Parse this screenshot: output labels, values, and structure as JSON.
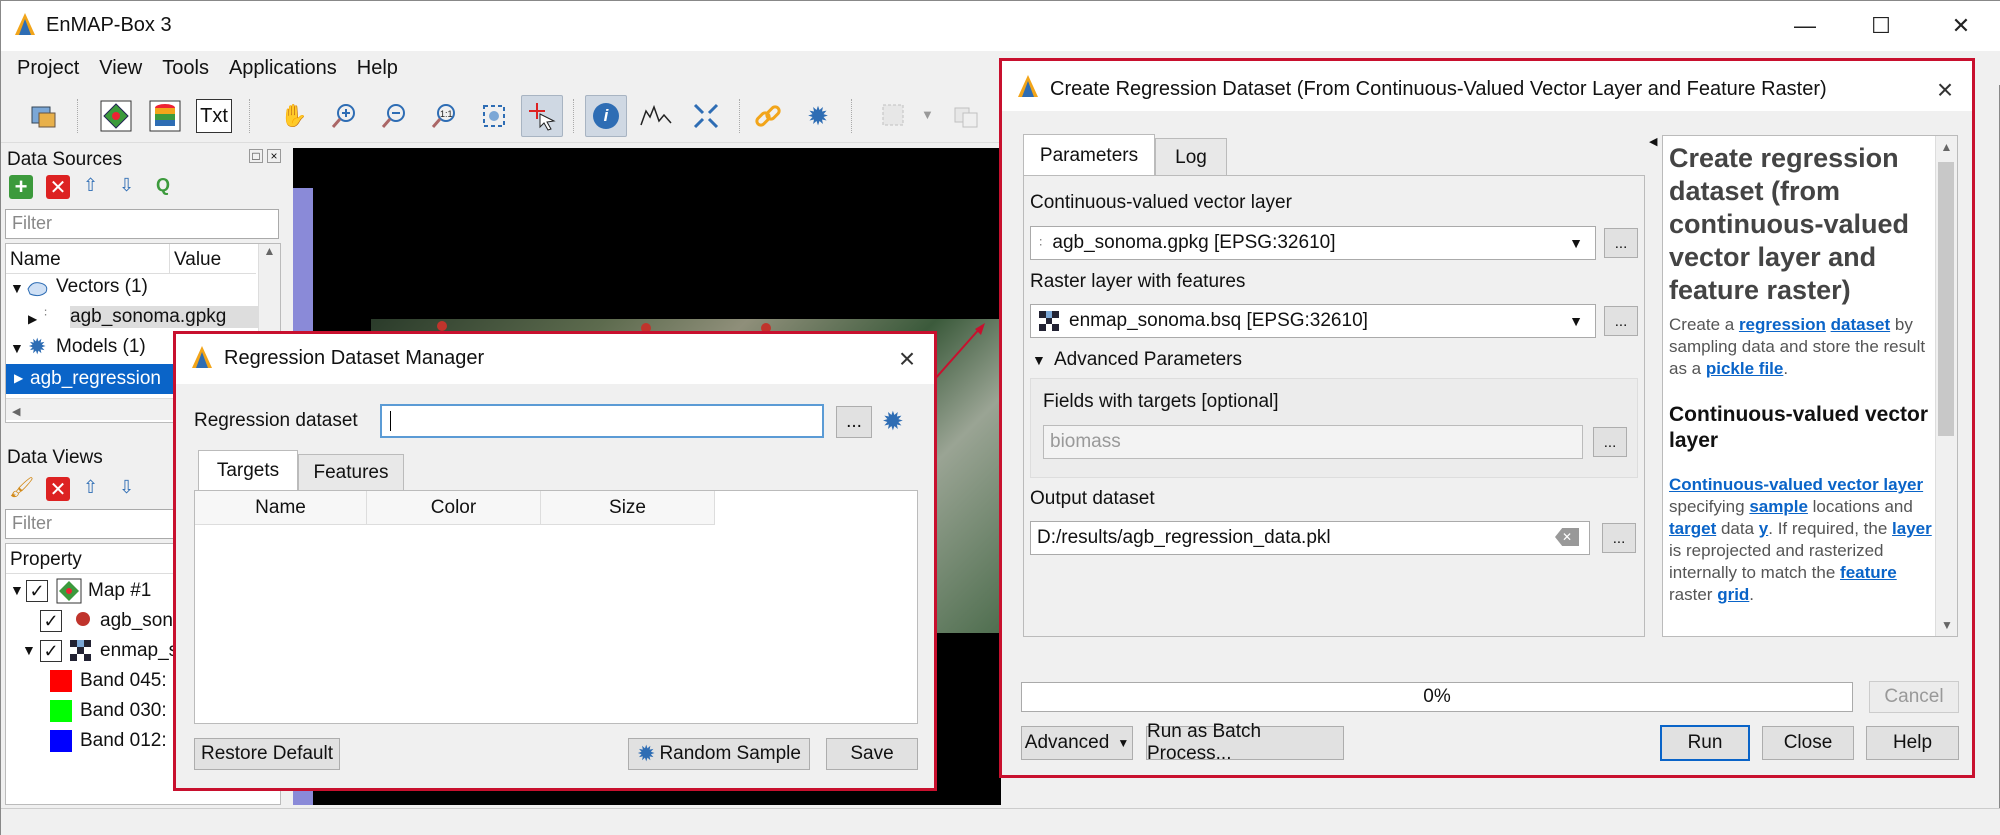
{
  "app": {
    "title": "EnMAP-Box 3",
    "menu": [
      "Project",
      "View",
      "Tools",
      "Applications",
      "Help"
    ],
    "toolbar_txt": "Txt"
  },
  "data_sources": {
    "title": "Data Sources",
    "filter_placeholder": "Filter",
    "col_name": "Name",
    "col_value": "Value",
    "vectors_label": "Vectors (1)",
    "vector_item": "agb_sonoma.gpkg",
    "models_label": "Models (1)",
    "model_item": "agb_regression"
  },
  "data_views": {
    "title": "Data Views",
    "filter_placeholder": "Filter",
    "col_property": "Property",
    "map_label": "Map #1",
    "layer1": "agb_son",
    "layer2": "enmap_s",
    "bands": [
      {
        "label": "Band 045:",
        "color": "#ff0000"
      },
      {
        "label": "Band 030:",
        "color": "#00ff00"
      },
      {
        "label": "Band 012:",
        "color": "#0000ff"
      }
    ]
  },
  "rdm": {
    "title": "Regression Dataset Manager",
    "dataset_label": "Regression dataset",
    "dataset_value": "",
    "browse": "...",
    "tabs": [
      "Targets",
      "Features"
    ],
    "columns": [
      "Name",
      "Color",
      "Size"
    ],
    "restore_default": "Restore Default",
    "random_sample": "Random Sample",
    "save": "Save"
  },
  "crd": {
    "title": "Create Regression Dataset (From Continuous-Valued Vector Layer and Feature Raster)",
    "tabs": [
      "Parameters",
      "Log"
    ],
    "vector_label": "Continuous-valued vector layer",
    "vector_value": "agb_sonoma.gpkg [EPSG:32610]",
    "raster_label": "Raster layer with features",
    "raster_value": "enmap_sonoma.bsq [EPSG:32610]",
    "advanced_params": "Advanced Parameters",
    "fields_label": "Fields with targets [optional]",
    "fields_value": "biomass",
    "output_label": "Output dataset",
    "output_value": "D:/results/agb_regression_data.pkl",
    "browse": "...",
    "progress_text": "0%",
    "progress": 0,
    "cancel": "Cancel",
    "advanced": "Advanced",
    "run_batch": "Run as Batch Process...",
    "run": "Run",
    "close": "Close",
    "help": "Help",
    "help_pane": {
      "heading": "Create regression dataset (from continuous-valued vector layer and feature raster)",
      "p1_a": "Create a ",
      "p1_link1": "regression",
      "p1_link2": "dataset",
      "p1_b": " by sampling data and store the result as a ",
      "p1_link3": "pickle file",
      "p1_c": ".",
      "sub": "Continuous-valued vector layer",
      "p2_link1": "Continuous-valued vector layer",
      "p2_a": " specifying ",
      "p2_link2": "sample",
      "p2_b": " locations and ",
      "p2_link3": "target",
      "p2_c": " data ",
      "p2_link4": "y",
      "p2_d": ". If required, the ",
      "p2_link5": "layer",
      "p2_e": " is reprojected and rasterized internally to match the ",
      "p2_link6": "feature",
      "p2_f": " raster ",
      "p2_link7": "grid",
      "p2_g": "."
    }
  },
  "colors": {
    "accent": "#0a64c8",
    "highlight_border": "#c8102e",
    "link": "#0a64c8"
  }
}
